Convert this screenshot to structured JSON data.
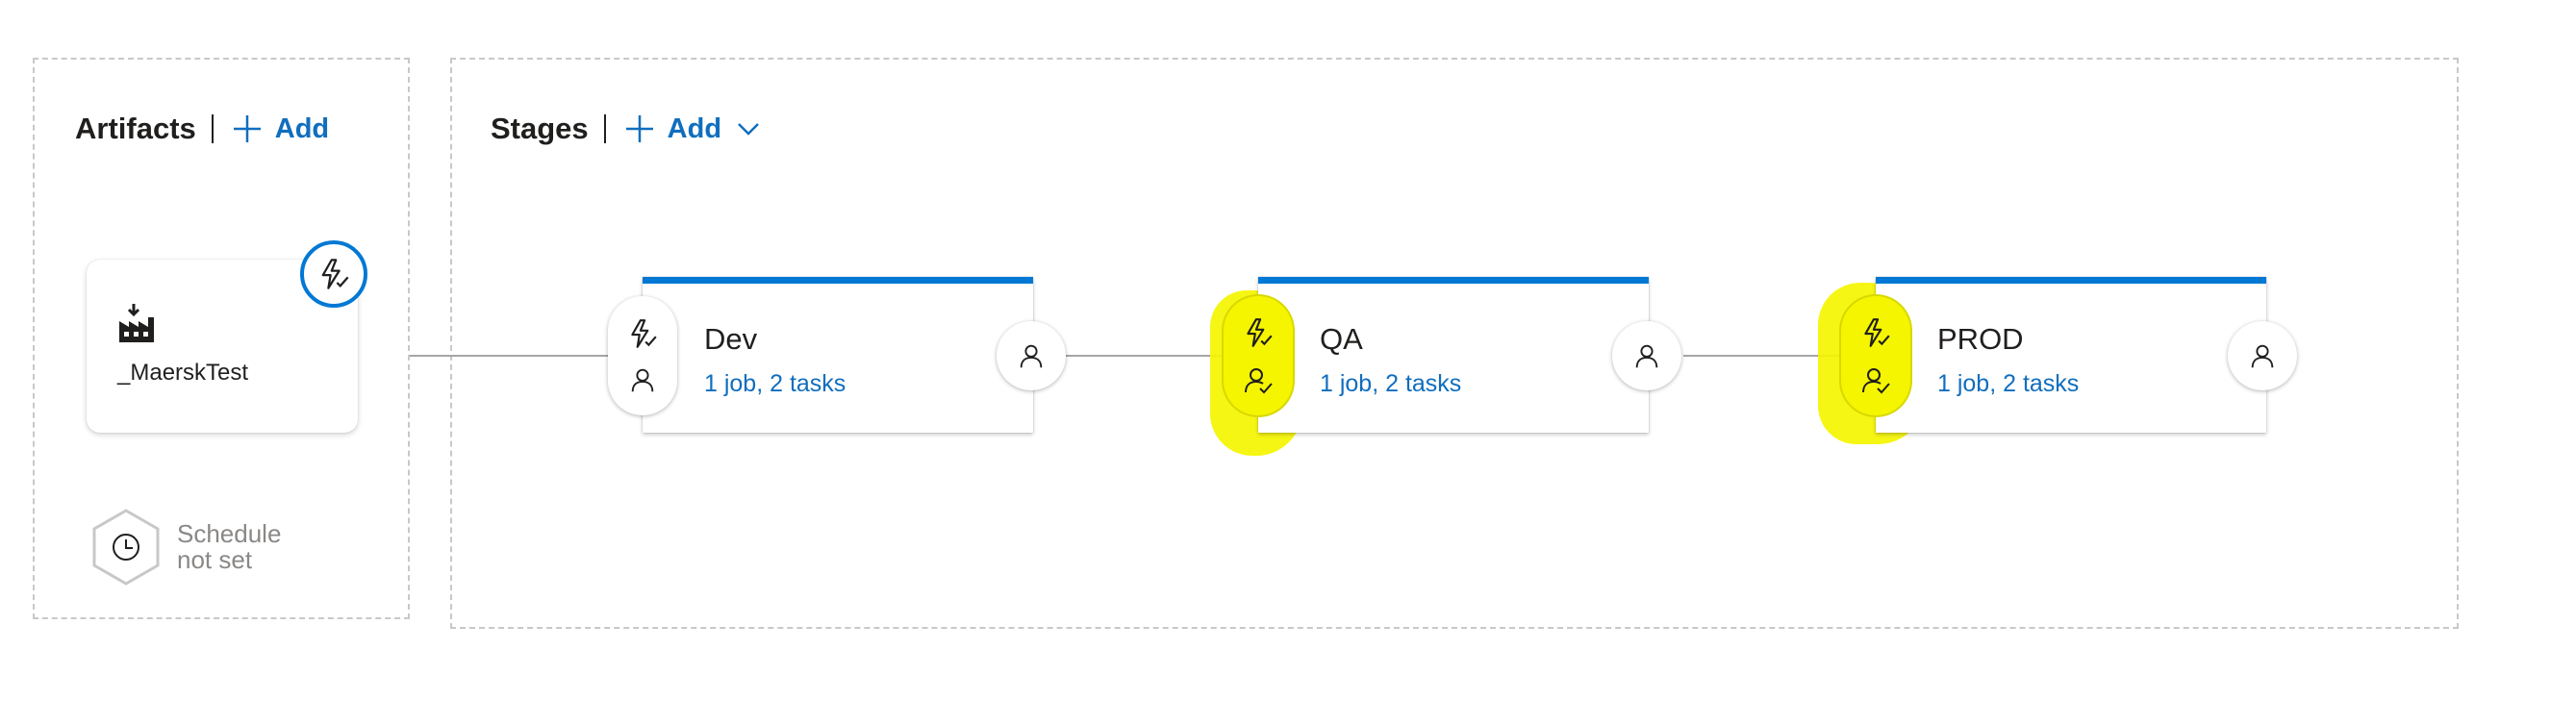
{
  "artifacts": {
    "title": "Artifacts",
    "add_label": "Add",
    "items": [
      {
        "name": "_MaerskTest",
        "icon": "build-factory-icon",
        "trigger_icon": "lightning-check-icon"
      }
    ],
    "schedule": {
      "line1": "Schedule",
      "line2": "not set",
      "icon": "clock-icon"
    }
  },
  "stages": {
    "title": "Stages",
    "add_label": "Add",
    "items": [
      {
        "name": "Dev",
        "tasks": "1 job, 2 tasks",
        "pre_icons": [
          "lightning-check-icon",
          "person-icon"
        ],
        "post_icon": "person-icon"
      },
      {
        "name": "QA",
        "tasks": "1 job, 2 tasks",
        "pre_icons": [
          "lightning-check-icon",
          "person-check-icon"
        ],
        "post_icon": "person-icon"
      },
      {
        "name": "PROD",
        "tasks": "1 job, 2 tasks",
        "pre_icons": [
          "lightning-check-icon",
          "person-check-icon"
        ],
        "post_icon": "person-icon"
      }
    ]
  },
  "colors": {
    "accent": "#0078d4",
    "link": "#106ebe",
    "highlight": "#f5f500",
    "connector": "#a6a6a6"
  }
}
